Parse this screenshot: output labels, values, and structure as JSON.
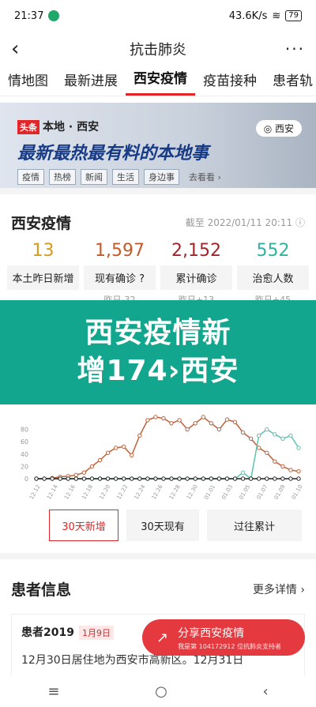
{
  "status_bar": {
    "time": "21:37",
    "speed": "43.6K/s",
    "battery": "79"
  },
  "header": {
    "title": "抗击肺炎",
    "back_icon": "back-arrow-icon",
    "more_icon": "more-dots-icon"
  },
  "tabs": [
    {
      "label": "情地图"
    },
    {
      "label": "最新进展"
    },
    {
      "label": "西安疫情",
      "active": true
    },
    {
      "label": "疫苗接种"
    },
    {
      "label": "患者轨"
    }
  ],
  "banner": {
    "tag": "头条",
    "heading": "本地 · 西安",
    "location": "西安",
    "slogan": "最新最热最有料的本地事",
    "chips": [
      "疫情",
      "热榜",
      "新闻",
      "生活",
      "身边事"
    ],
    "see_more": "去看看 ›"
  },
  "summary": {
    "title": "西安疫情",
    "update_time": "截至 2022/01/11 20:11",
    "stats": [
      {
        "value": "13",
        "label": "本土昨日新增",
        "delta": "",
        "color": "#d89a1b"
      },
      {
        "value": "1,597",
        "label": "现有确诊",
        "delta": "昨日-32",
        "color": "#c45a2a"
      },
      {
        "value": "2,152",
        "label": "累计确诊",
        "delta": "昨日+13",
        "color": "#a5232a"
      },
      {
        "value": "552",
        "label": "治愈人数",
        "delta": "昨日+45",
        "color": "#2fb3a0"
      }
    ]
  },
  "overlay": {
    "line1": "西安疫情新",
    "line2": "增174›西安"
  },
  "chart_data": {
    "type": "line",
    "y_ticks": [
      "80",
      "60",
      "40",
      "20",
      "0"
    ],
    "x_ticks": [
      "12.12",
      "12.14",
      "12.16",
      "12.18",
      "12.20",
      "12.22",
      "12.24",
      "12.26",
      "12.28",
      "12.30",
      "01.01",
      "01.03",
      "01.05",
      "01.07",
      "01.09",
      "01.10"
    ],
    "ylim": [
      0,
      100
    ],
    "series": [
      {
        "color": "#c0603a",
        "values": [
          0,
          0,
          1,
          3,
          4,
          6,
          10,
          20,
          30,
          42,
          50,
          52,
          38,
          70,
          95,
          100,
          98,
          90,
          95,
          80,
          90,
          100,
          90,
          80,
          96,
          92,
          75,
          65,
          50,
          42,
          28,
          20,
          14,
          12
        ]
      },
      {
        "color": "#5ac3b0",
        "values": [
          0,
          0,
          0,
          0,
          0,
          0,
          0,
          0,
          0,
          0,
          0,
          0,
          0,
          0,
          0,
          0,
          0,
          0,
          0,
          0,
          0,
          0,
          0,
          0,
          0,
          0,
          10,
          0,
          70,
          80,
          72,
          65,
          70,
          50
        ]
      },
      {
        "color": "#222222",
        "values": [
          0,
          0,
          0,
          0,
          0,
          0,
          0,
          0,
          0,
          0,
          0,
          0,
          0,
          0,
          0,
          0,
          0,
          0,
          0,
          0,
          0,
          0,
          0,
          0,
          0,
          0,
          0,
          0,
          0,
          0,
          0,
          0,
          0,
          0
        ]
      }
    ]
  },
  "chart_buttons": [
    {
      "label": "30天新增",
      "active": true
    },
    {
      "label": "30天现有"
    },
    {
      "label": "过往累计"
    }
  ],
  "patients": {
    "title": "患者信息",
    "more": "更多详情 ›",
    "card": {
      "name": "患者2019",
      "date": "1月9日",
      "desc": "12月30日居住地为西安市高新区。12月31日"
    }
  },
  "share": {
    "label": "分享西安疫情",
    "sub": "我是第 104172912 位抗肺炎支持者",
    "icon": "share-icon"
  },
  "nav": {
    "icons": [
      "menu-icon",
      "home-icon",
      "back-icon"
    ]
  }
}
